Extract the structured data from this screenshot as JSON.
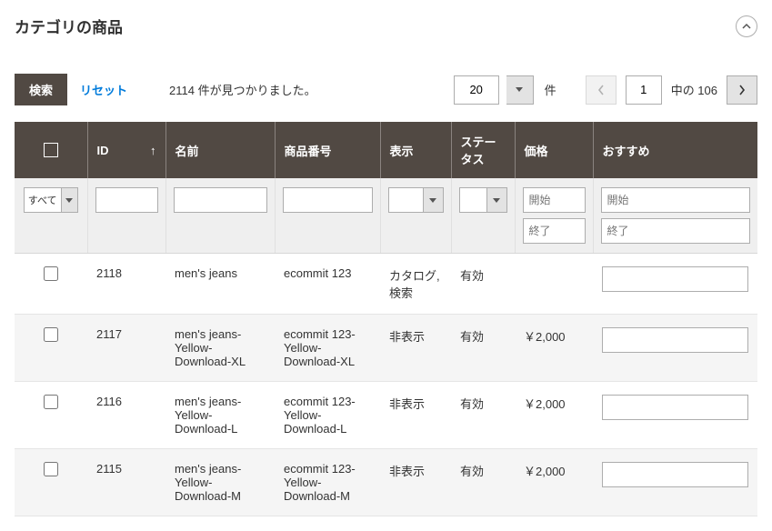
{
  "header": {
    "title": "カテゴリの商品"
  },
  "toolbar": {
    "search_label": "検索",
    "reset_label": "リセット",
    "records_found": "2114 件が見つかりました。",
    "pagesize_value": "20",
    "pagesize_unit": "件",
    "page_current": "1",
    "page_of": "中の 106"
  },
  "columns": {
    "checkbox": "",
    "id": "ID",
    "name": "名前",
    "sku": "商品番号",
    "visibility": "表示",
    "status": "ステータス",
    "price": "価格",
    "position": "おすすめ"
  },
  "filters": {
    "all_label": "すべて",
    "price_from": "開始",
    "price_to": "終了",
    "position_from": "開始",
    "position_to": "終了"
  },
  "rows": [
    {
      "id": "2118",
      "name": "men's jeans",
      "sku": "ecommit 123",
      "visibility": "カタログ, 検索",
      "status": "有効",
      "price": "",
      "position": ""
    },
    {
      "id": "2117",
      "name": "men's jeans-Yellow-Download-XL",
      "sku": "ecommit 123-Yellow-Download-XL",
      "visibility": "非表示",
      "status": "有効",
      "price": "￥2,000",
      "position": ""
    },
    {
      "id": "2116",
      "name": "men's jeans-Yellow-Download-L",
      "sku": "ecommit 123-Yellow-Download-L",
      "visibility": "非表示",
      "status": "有効",
      "price": "￥2,000",
      "position": ""
    },
    {
      "id": "2115",
      "name": "men's jeans-Yellow-Download-M",
      "sku": "ecommit 123-Yellow-Download-M",
      "visibility": "非表示",
      "status": "有効",
      "price": "￥2,000",
      "position": ""
    }
  ]
}
